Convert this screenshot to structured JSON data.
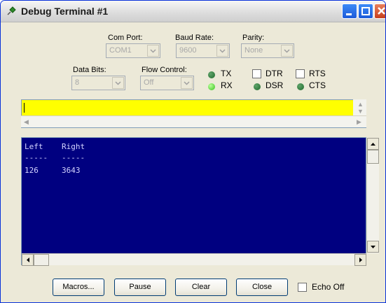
{
  "window": {
    "title": "Debug Terminal #1",
    "icons": {
      "app": "pin-icon",
      "minimize": "minimize-icon",
      "maximize": "maximize-icon",
      "close": "close-icon"
    }
  },
  "settings": {
    "com_port": {
      "label": "Com Port:",
      "value": "COM1"
    },
    "baud_rate": {
      "label": "Baud Rate:",
      "value": "9600"
    },
    "parity": {
      "label": "Parity:",
      "value": "None"
    },
    "data_bits": {
      "label": "Data Bits:",
      "value": "8"
    },
    "flow_control": {
      "label": "Flow Control:",
      "value": "Off"
    }
  },
  "signals": {
    "tx": {
      "label": "TX",
      "state": "dark-green"
    },
    "rx": {
      "label": "RX",
      "state": "bright-green"
    },
    "dtr": {
      "label": "DTR",
      "checked": false
    },
    "rts": {
      "label": "RTS",
      "checked": false
    },
    "dsr": {
      "label": "DSR",
      "state": "dark-green"
    },
    "cts": {
      "label": "CTS",
      "state": "dark-green"
    }
  },
  "transmit_pane": {
    "text": "",
    "background": "#ffff00"
  },
  "receive_pane": {
    "background": "#000080",
    "lines": [
      "Left    Right",
      "-----   -----",
      "126     3643"
    ]
  },
  "buttons": {
    "macros": "Macros...",
    "pause": "Pause",
    "clear": "Clear",
    "close": "Close",
    "echo_off": "Echo Off"
  }
}
